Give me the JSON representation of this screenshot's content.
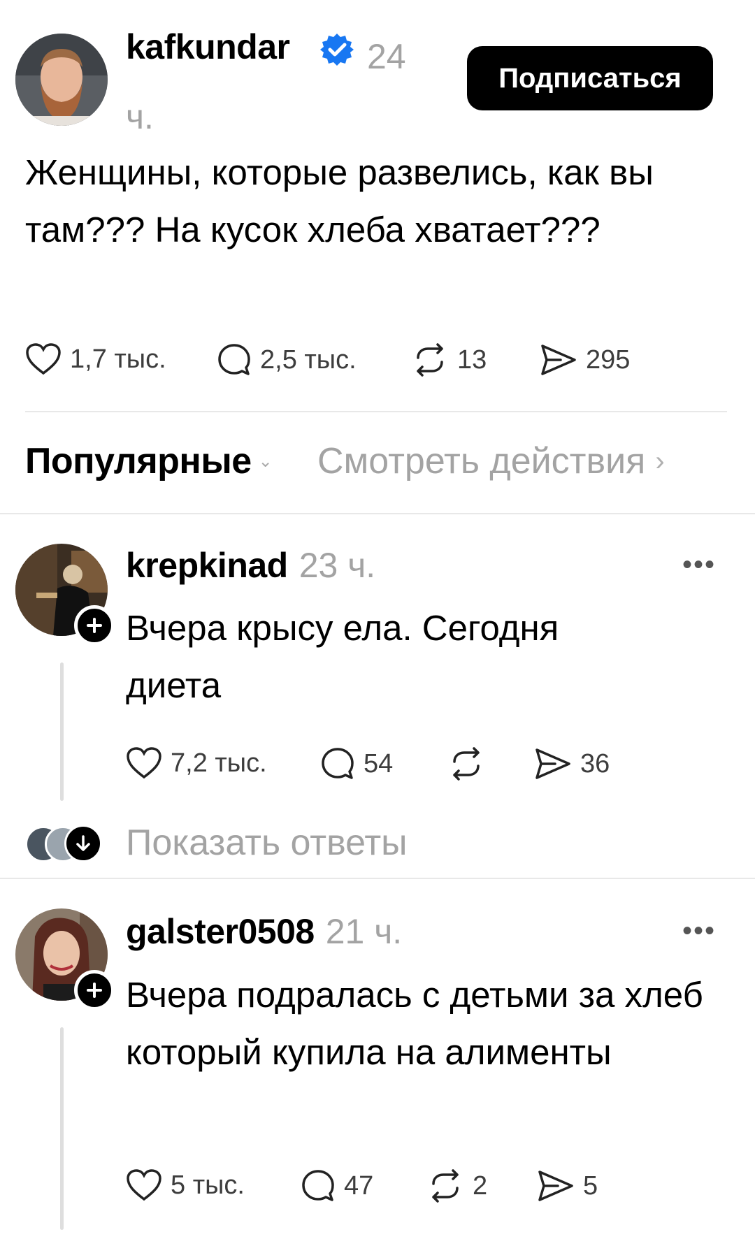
{
  "post": {
    "username": "kafkundar",
    "time": "24 ч.",
    "follow_label": "Подписаться",
    "text": "Женщины, которые развелись, как вы там??? На кусок хлеба хватает???",
    "likes": "1,7 тыс.",
    "comments": "2,5 тыс.",
    "reposts": "13",
    "shares": "295"
  },
  "sort": {
    "label": "Популярные",
    "activity_link": "Смотреть действия"
  },
  "comments": [
    {
      "username": "krepkinad",
      "time": "23 ч.",
      "text": "Вчера крысу ела. Сегодня диета",
      "likes": "7,2 тыс.",
      "comments": "54",
      "reposts": "",
      "shares": "36",
      "show_replies": "Показать ответы"
    },
    {
      "username": "galster0508",
      "time": "21 ч.",
      "text": "Вчера подралась с детьми за хлеб который купила на алименты",
      "likes": "5 тыс.",
      "comments": "47",
      "reposts": "2",
      "shares": "5"
    }
  ],
  "icons": {
    "verified": "verified-badge-icon",
    "like": "heart-icon",
    "comment": "comment-bubble-icon",
    "repost": "repost-icon",
    "share": "send-icon",
    "follow": "plus-icon",
    "more": "more-dots-icon"
  },
  "colors": {
    "verified": "#1877f2",
    "button_bg": "#000000",
    "muted_text": "#a3a3a3"
  }
}
